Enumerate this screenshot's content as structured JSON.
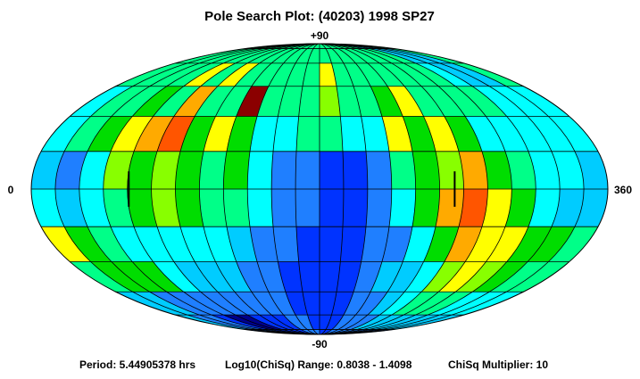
{
  "chart_data": {
    "type": "heatmap",
    "projection": "aitoff-hammer ellipse (longitude 0-360, latitude -90 to +90)",
    "title": "Pole Search Plot: (40203) 1998 SP27",
    "axis_labels": {
      "top": "+90",
      "bottom": "-90",
      "left": "0",
      "right": "360"
    },
    "grid": {
      "longitude_step_deg": 15,
      "latitude_step_deg": 15,
      "rows": 12,
      "cols": 24
    },
    "color_scale": {
      "metric": "Log10(ChiSq)",
      "min": 0.8038,
      "max": 1.4098,
      "low_to_high_colors": [
        "#00008b",
        "#0033ff",
        "#1f7fff",
        "#00ccff",
        "#00ffff",
        "#00ff88",
        "#00dd00",
        "#88ff00",
        "#ffff00",
        "#ffaa00",
        "#ff5500",
        "#8b0000"
      ]
    },
    "level_grid_note": "rows run from +90 (first) to -90 (last); columns run from longitude 0 to 360; values are color levels 0 (lowest ChiSq, dark blue) to 11 (highest, dark red)",
    "level_grid": [
      [
        5,
        5,
        5,
        5,
        5,
        5,
        5,
        5,
        5,
        5,
        5,
        5,
        5,
        5,
        5,
        5,
        5,
        5,
        5,
        3,
        3,
        3,
        5,
        5
      ],
      [
        5,
        5,
        5,
        5,
        5,
        5,
        5,
        5,
        5,
        5,
        5,
        5,
        5,
        5,
        5,
        5,
        5,
        5,
        5,
        5,
        3,
        3,
        3,
        5
      ],
      [
        5,
        5,
        5,
        5,
        8,
        5,
        8,
        5,
        5,
        5,
        5,
        5,
        8,
        5,
        5,
        5,
        5,
        5,
        5,
        5,
        4,
        3,
        3,
        5
      ],
      [
        4,
        5,
        5,
        6,
        5,
        9,
        5,
        5,
        11,
        5,
        5,
        5,
        7,
        5,
        5,
        6,
        8,
        5,
        5,
        5,
        5,
        4,
        4,
        4
      ],
      [
        4,
        5,
        6,
        8,
        9,
        10,
        6,
        8,
        6,
        4,
        4,
        5,
        5,
        4,
        4,
        8,
        6,
        8,
        6,
        4,
        4,
        4,
        4,
        4
      ],
      [
        3,
        2,
        4,
        7,
        6,
        7,
        6,
        5,
        6,
        4,
        2,
        2,
        1,
        1,
        2,
        5,
        6,
        7,
        9,
        6,
        5,
        4,
        4,
        3
      ],
      [
        4,
        3,
        4,
        5,
        6,
        7,
        6,
        5,
        5,
        4,
        2,
        2,
        1,
        1,
        2,
        4,
        6,
        9,
        10,
        8,
        6,
        4,
        3,
        3
      ],
      [
        8,
        6,
        5,
        4,
        4,
        4,
        4,
        4,
        3,
        2,
        2,
        1,
        1,
        1,
        2,
        2,
        4,
        6,
        9,
        8,
        8,
        6,
        6,
        5
      ],
      [
        5,
        6,
        6,
        6,
        4,
        3,
        3,
        3,
        2,
        2,
        1,
        1,
        1,
        1,
        2,
        3,
        3,
        4,
        7,
        8,
        7,
        6,
        5,
        5
      ],
      [
        3,
        3,
        2,
        2,
        2,
        2,
        2,
        2,
        2,
        2,
        1,
        1,
        1,
        1,
        2,
        2,
        3,
        4,
        5,
        5,
        5,
        4,
        4,
        4
      ],
      [
        3,
        2,
        2,
        1,
        0,
        0,
        1,
        1,
        1,
        2,
        2,
        1,
        1,
        1,
        2,
        2,
        2,
        3,
        3,
        3,
        3,
        3,
        3,
        3
      ],
      [
        2,
        2,
        2,
        2,
        1,
        1,
        1,
        1,
        1,
        2,
        2,
        2,
        1,
        1,
        2,
        2,
        2,
        2,
        2,
        2,
        2,
        2,
        2,
        2
      ]
    ],
    "best_solution_markers_lon_deg": [
      60,
      265
    ]
  },
  "footer": {
    "period": "Period: 5.44905378 hrs",
    "range": "Log10(ChiSq) Range: 0.8038 - 1.4098",
    "multiplier": "ChiSq Multiplier: 10"
  }
}
